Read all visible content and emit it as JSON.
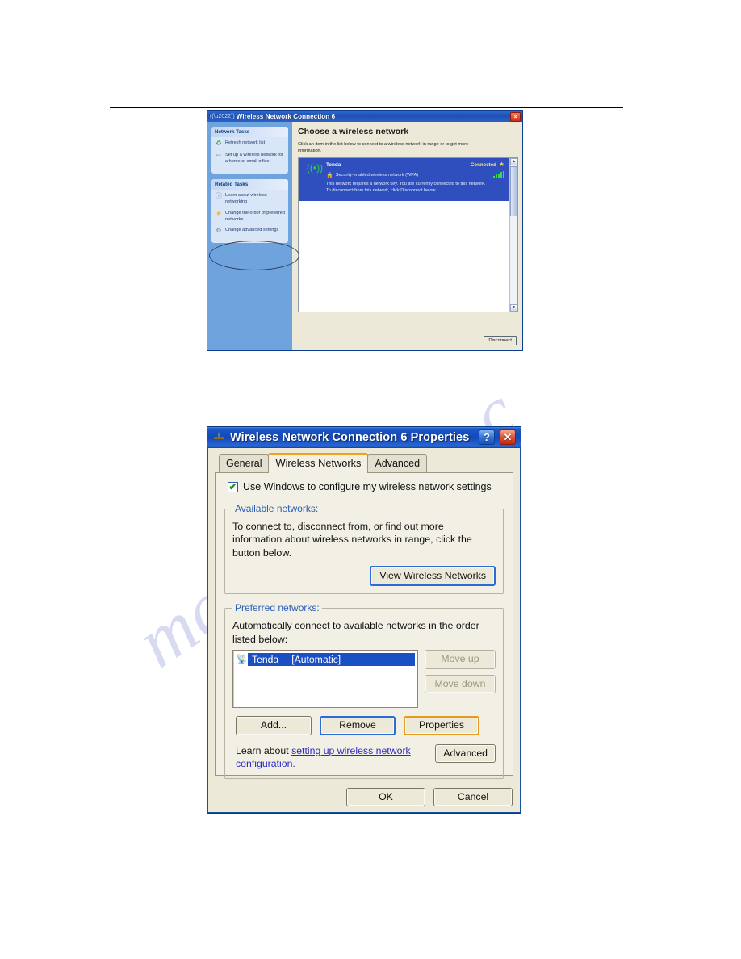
{
  "watermark": {
    "text": "manualshive.c"
  },
  "window1": {
    "title": "Wireless Network Connection 6",
    "title_icon": "wireless-signal-icon",
    "close_label": "×",
    "heading": "Choose a wireless network",
    "subtext": "Click an item in the list below to connect to a wireless network in range or to get more information.",
    "network_tasks": {
      "header": "Network Tasks",
      "items": [
        {
          "icon": "refresh-icon",
          "glyph": "♻",
          "label": "Refresh network list"
        },
        {
          "icon": "setup-wizard-icon",
          "glyph": "🖧",
          "label": "Set up a wireless network for a home or small office"
        }
      ]
    },
    "related_tasks": {
      "header": "Related Tasks",
      "items": [
        {
          "icon": "info-icon",
          "glyph": "ℹ",
          "label": "Learn about wireless networking"
        },
        {
          "icon": "star-icon",
          "glyph": "★",
          "label": "Change the order of preferred networks"
        },
        {
          "icon": "advanced-settings-icon",
          "glyph": "🔧",
          "label": "Change advanced settings"
        }
      ]
    },
    "network": {
      "ssid": "Tenda",
      "status": "Connected",
      "security": "Security-enabled wireless network (WPA)",
      "description": "This network requires a network key. You are currently connected to this network. To disconnect from this network, click Disconnect below.",
      "signal_bars": 5,
      "star_icon": "favorite-star-icon",
      "lock_icon": "lock-icon",
      "signal_icon": "signal-strength-icon"
    },
    "disconnect_label": "Disconnect",
    "scroll_up": "▲",
    "scroll_down": "▼"
  },
  "window2": {
    "title": "Wireless Network Connection 6 Properties",
    "title_icon": "network-adapter-icon",
    "help_label": "?",
    "close_label": "✕",
    "tabs": [
      {
        "label": "General",
        "active": false
      },
      {
        "label": "Wireless Networks",
        "active": true
      },
      {
        "label": "Advanced",
        "active": false
      }
    ],
    "use_windows": {
      "label": "Use Windows to configure my wireless network settings",
      "checked": true,
      "check_glyph": "✔"
    },
    "available": {
      "legend": "Available networks:",
      "text": "To connect to, disconnect from, or find out more information about wireless networks in range, click the button below.",
      "button": "View Wireless Networks"
    },
    "preferred": {
      "legend": "Preferred networks:",
      "text": "Automatically connect to available networks in the order listed below:",
      "items": [
        {
          "icon": "wireless-network-icon",
          "name": "Tenda",
          "mode": "[Automatic]",
          "selected": true
        }
      ],
      "move_up": "Move up",
      "move_down": "Move down",
      "add": "Add...",
      "remove": "Remove",
      "properties": "Properties"
    },
    "learn": {
      "prefix": "Learn about ",
      "link": "setting up wireless network configuration.",
      "advanced_button": "Advanced"
    },
    "ok": "OK",
    "cancel": "Cancel"
  }
}
